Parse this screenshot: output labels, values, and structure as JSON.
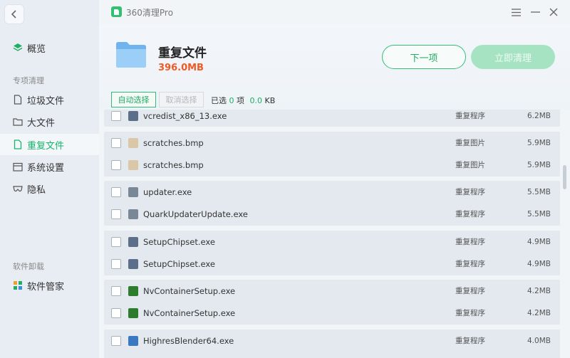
{
  "app": {
    "title": "360清理Pro"
  },
  "sidebar": {
    "overview": "概览",
    "section1": "专项清理",
    "items": [
      {
        "label": "垃圾文件",
        "icon": "file-icon"
      },
      {
        "label": "大文件",
        "icon": "folder-icon"
      },
      {
        "label": "重复文件",
        "icon": "file-icon"
      },
      {
        "label": "系统设置",
        "icon": "calendar-icon"
      },
      {
        "label": "隐私",
        "icon": "privacy-icon"
      }
    ],
    "section2": "软件卸载",
    "software": "软件管家"
  },
  "header": {
    "title": "重复文件",
    "size": "396.0MB",
    "next_label": "下一项",
    "clean_label": "立即清理"
  },
  "toolbar": {
    "auto_select": "自动选择",
    "cancel_select": "取消选择",
    "selected_prefix": "已选",
    "selected_count": "0",
    "selected_unit": "项",
    "selected_size": "0.0",
    "size_unit": "KB"
  },
  "files": [
    {
      "name": "vcredist_x86_13.exe",
      "type": "重复程序",
      "size": "6.2MB",
      "icon_color": "#5b6f8a"
    },
    {
      "name": "scratches.bmp",
      "type": "重复图片",
      "size": "5.9MB",
      "icon_color": "#d9c7a8"
    },
    {
      "name": "scratches.bmp",
      "type": "重复图片",
      "size": "5.9MB",
      "icon_color": "#d9c7a8"
    },
    {
      "name": "updater.exe",
      "type": "重复程序",
      "size": "5.5MB",
      "icon_color": "#7a8796"
    },
    {
      "name": "QuarkUpdaterUpdate.exe",
      "type": "重复程序",
      "size": "5.5MB",
      "icon_color": "#7a8796"
    },
    {
      "name": "SetupChipset.exe",
      "type": "重复程序",
      "size": "4.9MB",
      "icon_color": "#5b6f8a"
    },
    {
      "name": "SetupChipset.exe",
      "type": "重复程序",
      "size": "4.9MB",
      "icon_color": "#5b6f8a"
    },
    {
      "name": "NvContainerSetup.exe",
      "type": "重复程序",
      "size": "4.2MB",
      "icon_color": "#2e7d2e"
    },
    {
      "name": "NvContainerSetup.exe",
      "type": "重复程序",
      "size": "4.2MB",
      "icon_color": "#2e7d2e"
    },
    {
      "name": "HighresBlender64.exe",
      "type": "重复程序",
      "size": "4.0MB",
      "icon_color": "#3a78c2"
    }
  ]
}
